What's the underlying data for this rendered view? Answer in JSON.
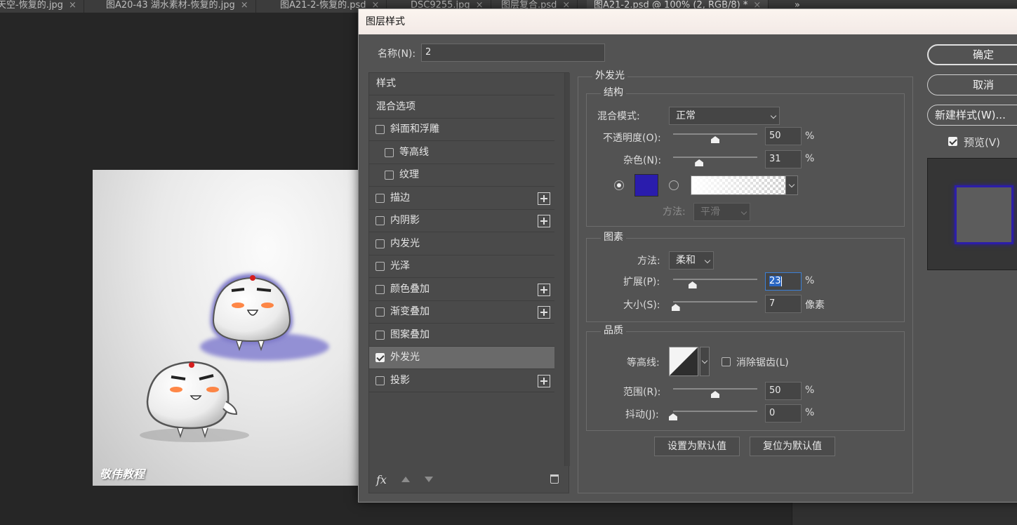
{
  "tabs": [
    {
      "label": "天空-恢复的.jpg",
      "active": false
    },
    {
      "label": "图A20-43 湖水素材-恢复的.jpg",
      "active": false
    },
    {
      "label": "图A21-2-恢复的.psd",
      "active": false
    },
    {
      "label": "DSC9255.jpg",
      "active": false
    },
    {
      "label": "图层复合.psd",
      "active": false
    },
    {
      "label": "图A21-2.psd @ 100% (2, RGB/8) *",
      "active": true
    }
  ],
  "tab_close_glyph": "×",
  "tab_overflow_glyph": "»",
  "canvas": {
    "watermark": "敬伟教程"
  },
  "dialog": {
    "title": "图层样式",
    "name_label": "名称(N):",
    "name_value": "2",
    "styles_list": {
      "items": [
        {
          "label": "样式",
          "type": "plain",
          "checked": false,
          "has_plus": false
        },
        {
          "label": "混合选项",
          "type": "plain",
          "checked": false,
          "has_plus": false
        },
        {
          "label": "斜面和浮雕",
          "type": "check",
          "checked": false,
          "has_plus": false
        },
        {
          "label": "等高线",
          "type": "sub",
          "checked": false,
          "has_plus": false
        },
        {
          "label": "纹理",
          "type": "sub",
          "checked": false,
          "has_plus": false
        },
        {
          "label": "描边",
          "type": "check",
          "checked": false,
          "has_plus": true
        },
        {
          "label": "内阴影",
          "type": "check",
          "checked": false,
          "has_plus": true
        },
        {
          "label": "内发光",
          "type": "check",
          "checked": false,
          "has_plus": false
        },
        {
          "label": "光泽",
          "type": "check",
          "checked": false,
          "has_plus": false
        },
        {
          "label": "颜色叠加",
          "type": "check",
          "checked": false,
          "has_plus": true
        },
        {
          "label": "渐变叠加",
          "type": "check",
          "checked": false,
          "has_plus": true
        },
        {
          "label": "图案叠加",
          "type": "check",
          "checked": false,
          "has_plus": false
        },
        {
          "label": "外发光",
          "type": "check",
          "checked": true,
          "has_plus": false,
          "selected": true
        },
        {
          "label": "投影",
          "type": "check",
          "checked": false,
          "has_plus": true
        }
      ],
      "footer_fx": "fx"
    },
    "outer_glow": {
      "title": "外发光",
      "structure": {
        "title": "结构",
        "blend_mode_label": "混合模式:",
        "blend_mode_value": "正常",
        "opacity_label": "不透明度(O):",
        "opacity_value": "50",
        "opacity_slider": 0.5,
        "noise_label": "杂色(N):",
        "noise_value": "31",
        "noise_slider": 0.31,
        "percent": "%",
        "glow_color": "#2a1cad",
        "method_label": "方法:",
        "method_value": "平滑"
      },
      "elements": {
        "title": "图素",
        "technique_label": "方法:",
        "technique_value": "柔和",
        "spread_label": "扩展(P):",
        "spread_value": "23",
        "spread_slider": 0.23,
        "size_label": "大小(S):",
        "size_value": "7",
        "size_slider": 0.03,
        "size_unit": "像素",
        "percent": "%"
      },
      "quality": {
        "title": "品质",
        "contour_label": "等高线:",
        "antialias_label": "消除锯齿(L)",
        "antialias_checked": false,
        "range_label": "范围(R):",
        "range_value": "50",
        "range_slider": 0.5,
        "jitter_label": "抖动(J):",
        "jitter_value": "0",
        "jitter_slider": 0,
        "percent": "%"
      },
      "make_default_label": "设置为默认值",
      "reset_default_label": "复位为默认值"
    },
    "ok_label": "确定",
    "cancel_label": "取消",
    "new_style_label": "新建样式(W)...",
    "preview_label": "预览(V)",
    "preview_checked": true
  }
}
